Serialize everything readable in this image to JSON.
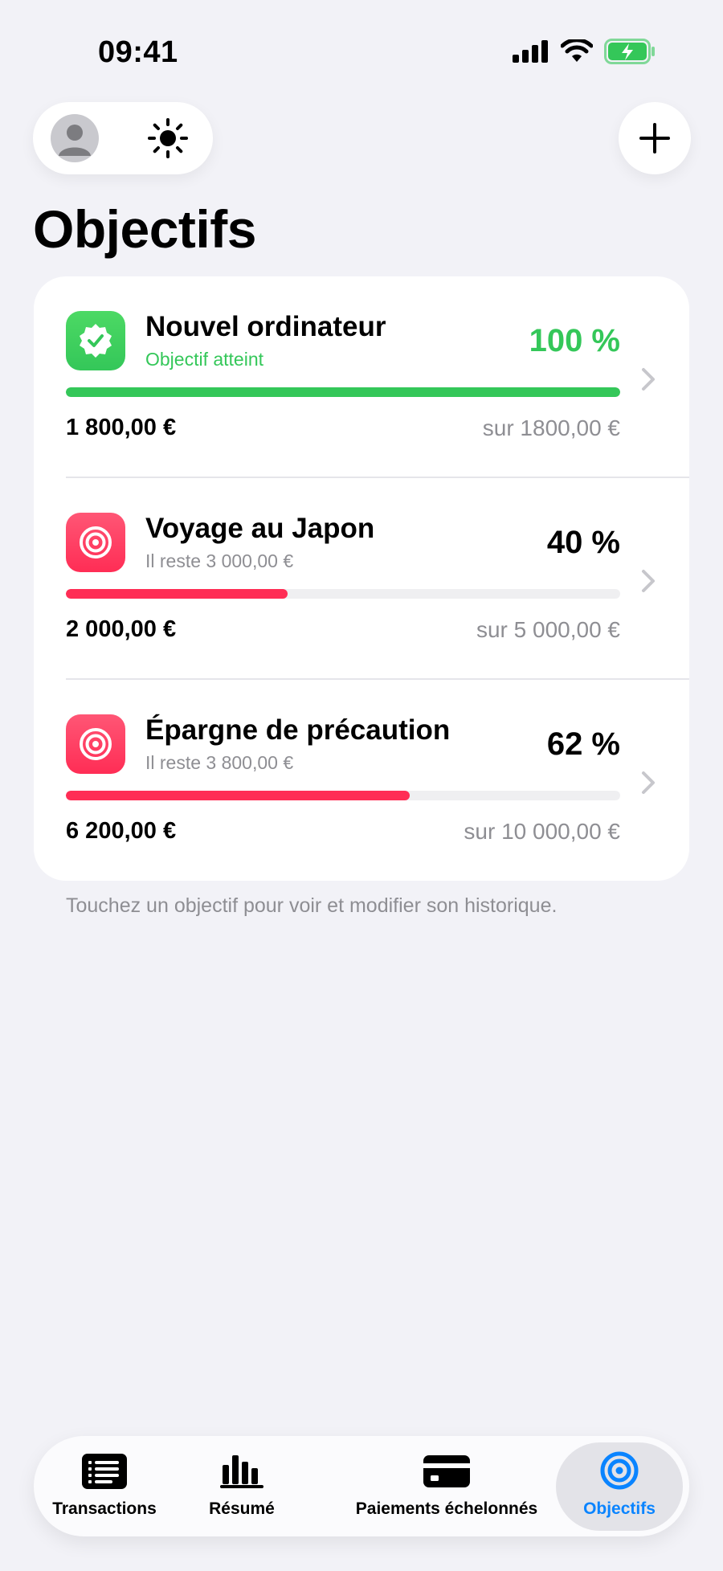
{
  "status_bar": {
    "time": "09:41"
  },
  "header": {
    "title": "Objectifs"
  },
  "goals": [
    {
      "name": "Nouvel ordinateur",
      "subtitle": "Objectif atteint",
      "percent": "100 %",
      "progress": 1.0,
      "amount": "1 800,00 €",
      "target": "sur 1800,00 €",
      "icon": "checkmark-seal-icon",
      "color": "#34c759"
    },
    {
      "name": "Voyage au Japon",
      "subtitle": "Il reste 3 000,00 €",
      "percent": "40 %",
      "progress": 0.4,
      "amount": "2 000,00 €",
      "target": "sur 5 000,00 €",
      "icon": "target-icon",
      "color": "#ff2d55"
    },
    {
      "name": "Épargne de précaution",
      "subtitle": "Il reste 3 800,00 €",
      "percent": "62 %",
      "progress": 0.62,
      "amount": "6 200,00 €",
      "target": "sur 10 000,00 €",
      "icon": "target-icon",
      "color": "#ff2d55"
    }
  ],
  "hint": "Touchez un objectif pour voir et modifier son historique.",
  "tab_bar": {
    "tabs": [
      {
        "label": "Transactions",
        "icon": "list-icon",
        "active": false
      },
      {
        "label": "Résumé",
        "icon": "bar-chart-icon",
        "active": false
      },
      {
        "label": "Paiements échelonnés",
        "icon": "credit-card-icon",
        "active": false
      },
      {
        "label": "Objectifs",
        "icon": "target-icon",
        "active": true
      }
    ],
    "active_color": "#0a84ff"
  }
}
